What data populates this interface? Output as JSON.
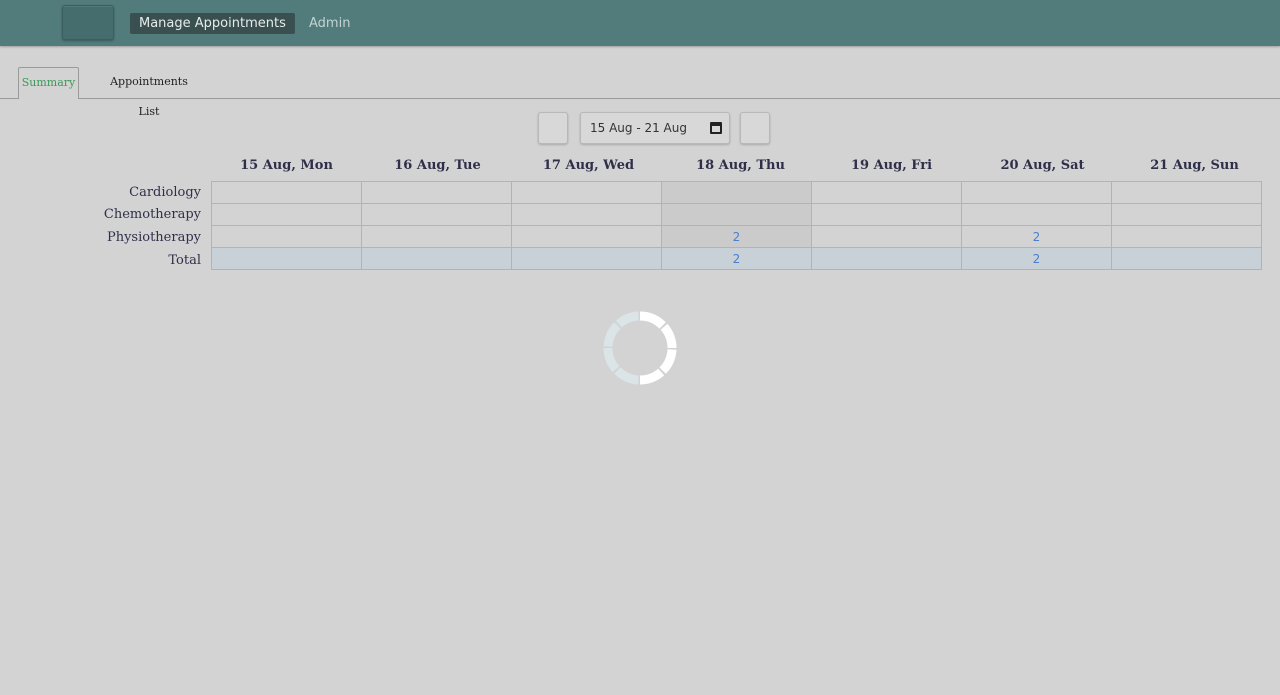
{
  "nav": {
    "home_icon": "",
    "active_label": "Manage Appointments",
    "admin_label": "Admin"
  },
  "tabs": [
    {
      "label": "Summary",
      "active": true
    },
    {
      "label": "Appointments List",
      "active": false
    }
  ],
  "pager": {
    "prev_icon": "",
    "next_icon": "",
    "date_range": "15 Aug - 21 Aug"
  },
  "columns": [
    "15 Aug, Mon",
    "16 Aug, Tue",
    "17 Aug, Wed",
    "18 Aug, Thu",
    "19 Aug, Fri",
    "20 Aug, Sat",
    "21 Aug, Sun"
  ],
  "highlighted_column": "18 Aug, Thu",
  "rows": [
    {
      "label": "Cardiology",
      "cells": [
        "",
        "",
        "",
        "",
        "",
        "",
        ""
      ]
    },
    {
      "label": "Chemotherapy",
      "cells": [
        "",
        "",
        "",
        "",
        "",
        "",
        ""
      ]
    },
    {
      "label": "Physiotherapy",
      "cells": [
        "",
        "",
        "",
        "2",
        "",
        "2",
        ""
      ]
    },
    {
      "label": "Total",
      "cells": [
        "",
        "",
        "",
        "2",
        "",
        "2",
        ""
      ]
    }
  ],
  "colors": {
    "header_bar": "#527c7c",
    "active_tab_text": "#3c9a5a",
    "count_link": "#4a7fd0",
    "total_row": "#c8d0d8"
  }
}
